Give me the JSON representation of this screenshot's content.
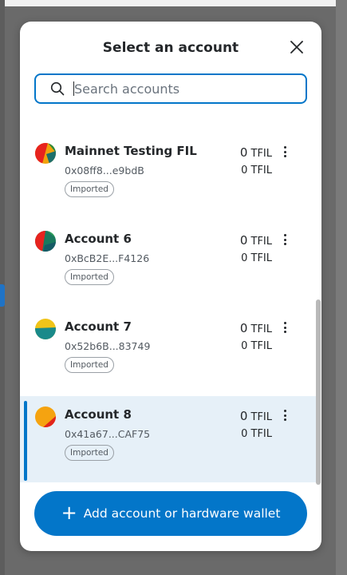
{
  "modal": {
    "title": "Select an account",
    "close_icon": "close-icon"
  },
  "search": {
    "placeholder": "Search accounts",
    "value": "",
    "icon": "search-icon"
  },
  "accounts": [
    {
      "name": "Mainnet Testing FIL",
      "address": "0x08ff8...e9bdB",
      "badge": "Imported",
      "balance_value": "0",
      "balance_unit": "TFIL",
      "secondary_balance": "0 TFIL",
      "selected": false
    },
    {
      "name": "Account 6",
      "address": "0xBcB2E...F4126",
      "badge": "Imported",
      "balance_value": "0",
      "balance_unit": "TFIL",
      "secondary_balance": "0 TFIL",
      "selected": false
    },
    {
      "name": "Account 7",
      "address": "0x52b6B...83749",
      "badge": "Imported",
      "balance_value": "0",
      "balance_unit": "TFIL",
      "secondary_balance": "0 TFIL",
      "selected": false
    },
    {
      "name": "Account 8",
      "address": "0x41a67...CAF75",
      "badge": "Imported",
      "balance_value": "0",
      "balance_unit": "TFIL",
      "secondary_balance": "0 TFIL",
      "selected": true
    }
  ],
  "footer": {
    "add_label": "Add account or hardware wallet",
    "add_icon": "plus-icon"
  },
  "colors": {
    "accent": "#0376c9",
    "selected_bg": "#e6f0f8"
  }
}
